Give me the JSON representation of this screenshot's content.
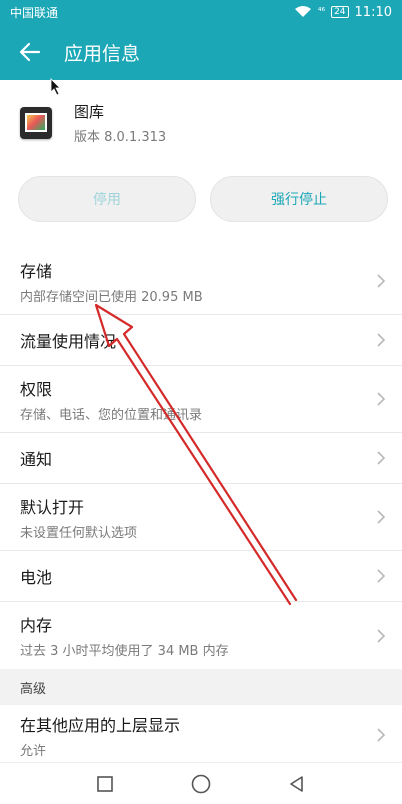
{
  "status_bar": {
    "carrier": "中国联通",
    "signal": "⁴⁶",
    "battery": "24",
    "time": "11:10"
  },
  "header": {
    "title": "应用信息"
  },
  "app": {
    "name": "图库",
    "version": "版本 8.0.1.313"
  },
  "buttons": {
    "disable": "停用",
    "force_stop": "强行停止"
  },
  "list": {
    "storage": {
      "label": "存储",
      "sub": "内部存储空间已使用 20.95 MB"
    },
    "data_usage": {
      "label": "流量使用情况"
    },
    "permissions": {
      "label": "权限",
      "sub": "存储、电话、您的位置和通讯录"
    },
    "notifications": {
      "label": "通知"
    },
    "open_by_default": {
      "label": "默认打开",
      "sub": "未设置任何默认选项"
    },
    "battery": {
      "label": "电池"
    },
    "memory": {
      "label": "内存",
      "sub": "过去 3 小时平均使用了 34 MB 内存"
    }
  },
  "advanced": {
    "header": "高级",
    "overlay": {
      "label": "在其他应用的上层显示",
      "sub": "允许"
    }
  },
  "colors": {
    "accent": "#1ba7b6",
    "annotation": "#d42a2a"
  }
}
